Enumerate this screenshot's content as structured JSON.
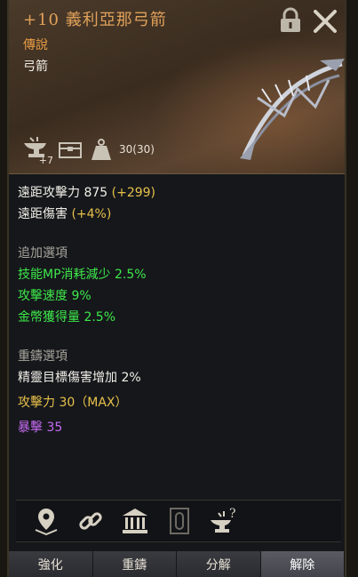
{
  "item": {
    "title": "+10 義利亞那弓箭",
    "grade": "傳說",
    "type": "弓箭",
    "enchant_badge": "+7",
    "weight": "30(30)"
  },
  "base_stats": [
    {
      "label": "遠距攻擊力 875",
      "bonus": "(+299)"
    },
    {
      "label": "遠距傷害",
      "bonus": "(+4%)"
    }
  ],
  "extra_options": {
    "header": "追加選項",
    "lines": [
      "技能MP消耗減少 2.5%",
      "攻擊速度 9%",
      "金幣獲得量 2.5%"
    ]
  },
  "reforge_options": {
    "header": "重鑄選項",
    "line1": "精靈目標傷害增加 2%",
    "line2": "攻擊力 30（MAX）",
    "line3": "暴擊 35"
  },
  "actions": [
    "強化",
    "重鑄",
    "分解",
    "解除"
  ],
  "icons": [
    "location-pin-icon",
    "link-icon",
    "bank-icon",
    "slot-icon",
    "anvil-help-icon"
  ],
  "colors": {
    "title": "#e0a15a",
    "green_option": "#3ee84a",
    "purple_option": "#c46af0"
  }
}
